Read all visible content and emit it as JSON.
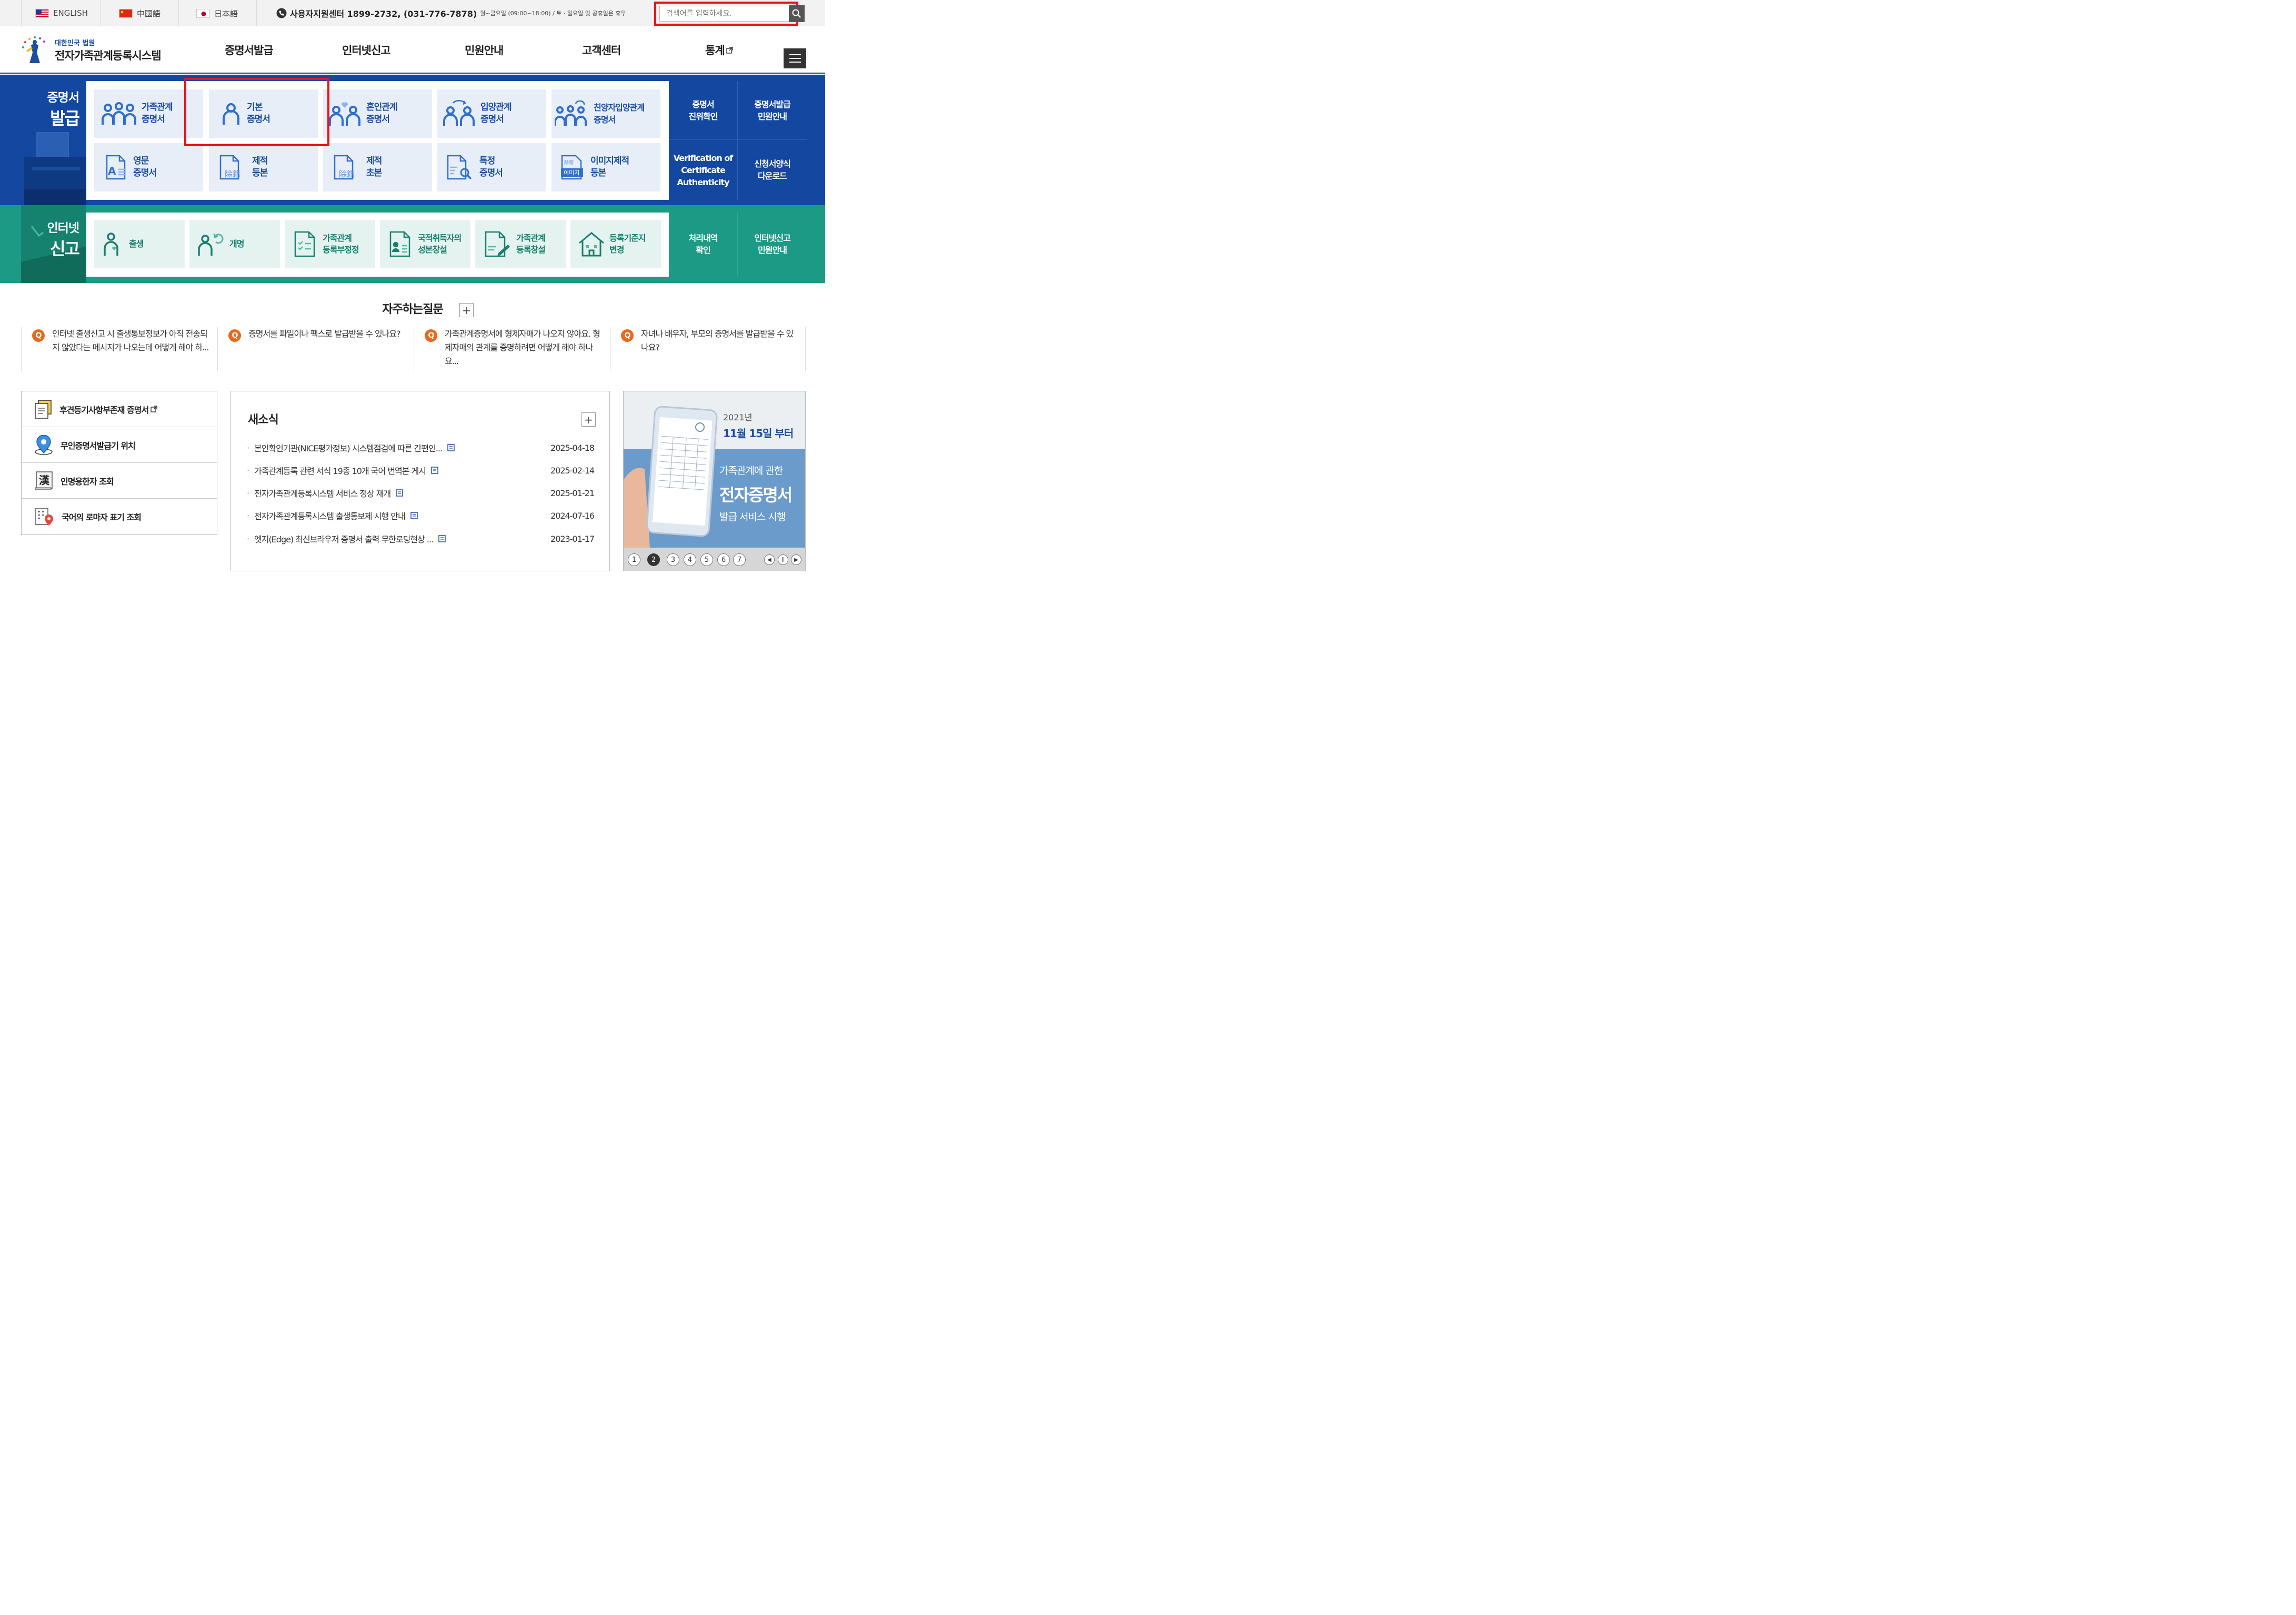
{
  "topbar": {
    "languages": [
      {
        "label": "ENGLISH"
      },
      {
        "label": "中國語"
      },
      {
        "label": "日本語"
      }
    ],
    "support_label": "사용자지원센터 1899-2732, (031-776-7878)",
    "support_hours": "월~금요일 (09:00~18:00) / 토 · 일요일 및 공휴일은 휴무",
    "search_placeholder": "검색어를 입력하세요."
  },
  "header": {
    "logo_sub": "대한민국 법원",
    "logo_main": "전자가족관계등록시스템",
    "nav": [
      "증명서발급",
      "인터넷신고",
      "민원안내",
      "고객센터",
      "통계"
    ]
  },
  "cert": {
    "title_1": "증명서",
    "title_2": "발급",
    "tiles": [
      {
        "label": "가족관계\n증명서",
        "icon": "family-icon"
      },
      {
        "label": "기본\n증명서",
        "icon": "person-icon"
      },
      {
        "label": "혼인관계\n증명서",
        "icon": "couple-heart-icon"
      },
      {
        "label": "입양관계\n증명서",
        "icon": "adoption-icon"
      },
      {
        "label": "친양자입양관계\n증명서",
        "icon": "family-adoption-icon"
      },
      {
        "label": "영문\n증명서",
        "icon": "english-doc-icon"
      },
      {
        "label": "제적\n등본",
        "icon": "removed-register-doc-icon"
      },
      {
        "label": "제적\n초본",
        "icon": "removed-abstract-doc-icon"
      },
      {
        "label": "특정\n증명서",
        "icon": "search-doc-icon"
      },
      {
        "label": "이미지제적\n등본",
        "icon": "image-register-icon"
      }
    ],
    "side": [
      {
        "label": "증명서\n진위확인"
      },
      {
        "label": "증명서발급\n민원안내"
      },
      {
        "label": "Verification of\nCertificate\nAuthenticity"
      },
      {
        "label": "신청서양식\n다운로드"
      }
    ]
  },
  "report": {
    "title_1": "인터넷",
    "title_2": "신고",
    "tiles": [
      {
        "label": "출생",
        "icon": "birth-icon"
      },
      {
        "label": "개명",
        "icon": "rename-icon"
      },
      {
        "label": "가족관계\n등록부정정",
        "icon": "correction-doc-icon"
      },
      {
        "label": "국적취득자의\n성본창설",
        "icon": "nationality-doc-icon"
      },
      {
        "label": "가족관계\n등록창설",
        "icon": "create-register-icon"
      },
      {
        "label": "등록기준지\n변경",
        "icon": "house-icon"
      }
    ],
    "side": [
      {
        "label": "처리내역\n확인"
      },
      {
        "label": "인터넷신고\n민원안내"
      }
    ]
  },
  "faq": {
    "title": "자주하는질문",
    "q_badge": "Q",
    "items": [
      {
        "text": "인터넷 출생신고 시 출생통보정보가 아직 전송되지 않았다는 메시지가 나오는데 어떻게 해야 하..."
      },
      {
        "text": "증명서를 파일이나 팩스로 발급받을 수 있나요?"
      },
      {
        "text": "가족관계증명서에 형제자매가 나오지 않아요. 형제자매의 관계를 증명하려면 어떻게 해야 하나요..."
      },
      {
        "text": "자녀나 배우자, 부모의 증명서를 발급받을 수 있나요?"
      }
    ]
  },
  "quick_links": [
    {
      "label": "후견등기사항부존재 증명서",
      "icon": "document-icon"
    },
    {
      "label": "무인증명서발급기 위치",
      "icon": "location-pin-icon"
    },
    {
      "label": "인명용한자 조회",
      "icon": "hanja-book-icon"
    },
    {
      "label": "국어의 로마자 표기 조회",
      "icon": "building-pin-icon"
    }
  ],
  "news": {
    "title": "새소식",
    "items": [
      {
        "title": "본인확인기관(NICE평가정보) 시스템점검에 따른 간편인...",
        "date": "2025-04-18"
      },
      {
        "title": "가족관계등록 관련 서식 19종 10개 국어 번역본 게시",
        "date": "2025-02-14"
      },
      {
        "title": "전자가족관계등록시스템 서비스 정상 재개",
        "date": "2025-01-21"
      },
      {
        "title": "전자가족관계등록시스템 출생통보제 시행 안내",
        "date": "2024-07-16"
      },
      {
        "title": "엣지(Edge) 최신브라우저 증명서 출력 무한로딩현상 ...",
        "date": "2023-01-17"
      }
    ]
  },
  "banner": {
    "year": "2021년",
    "date": "11월 15일 부터",
    "line1": "가족관계에 관한",
    "line2": "전자증명서",
    "line3": "발급 서비스 시행",
    "pages": [
      "1",
      "2",
      "3",
      "4",
      "5",
      "6",
      "7"
    ],
    "active_page": 2
  },
  "colors": {
    "cert_blue": "#1447a0",
    "report_green": "#1c9a85",
    "highlight_red": "#e8141b",
    "faq_orange": "#e66a1e"
  }
}
